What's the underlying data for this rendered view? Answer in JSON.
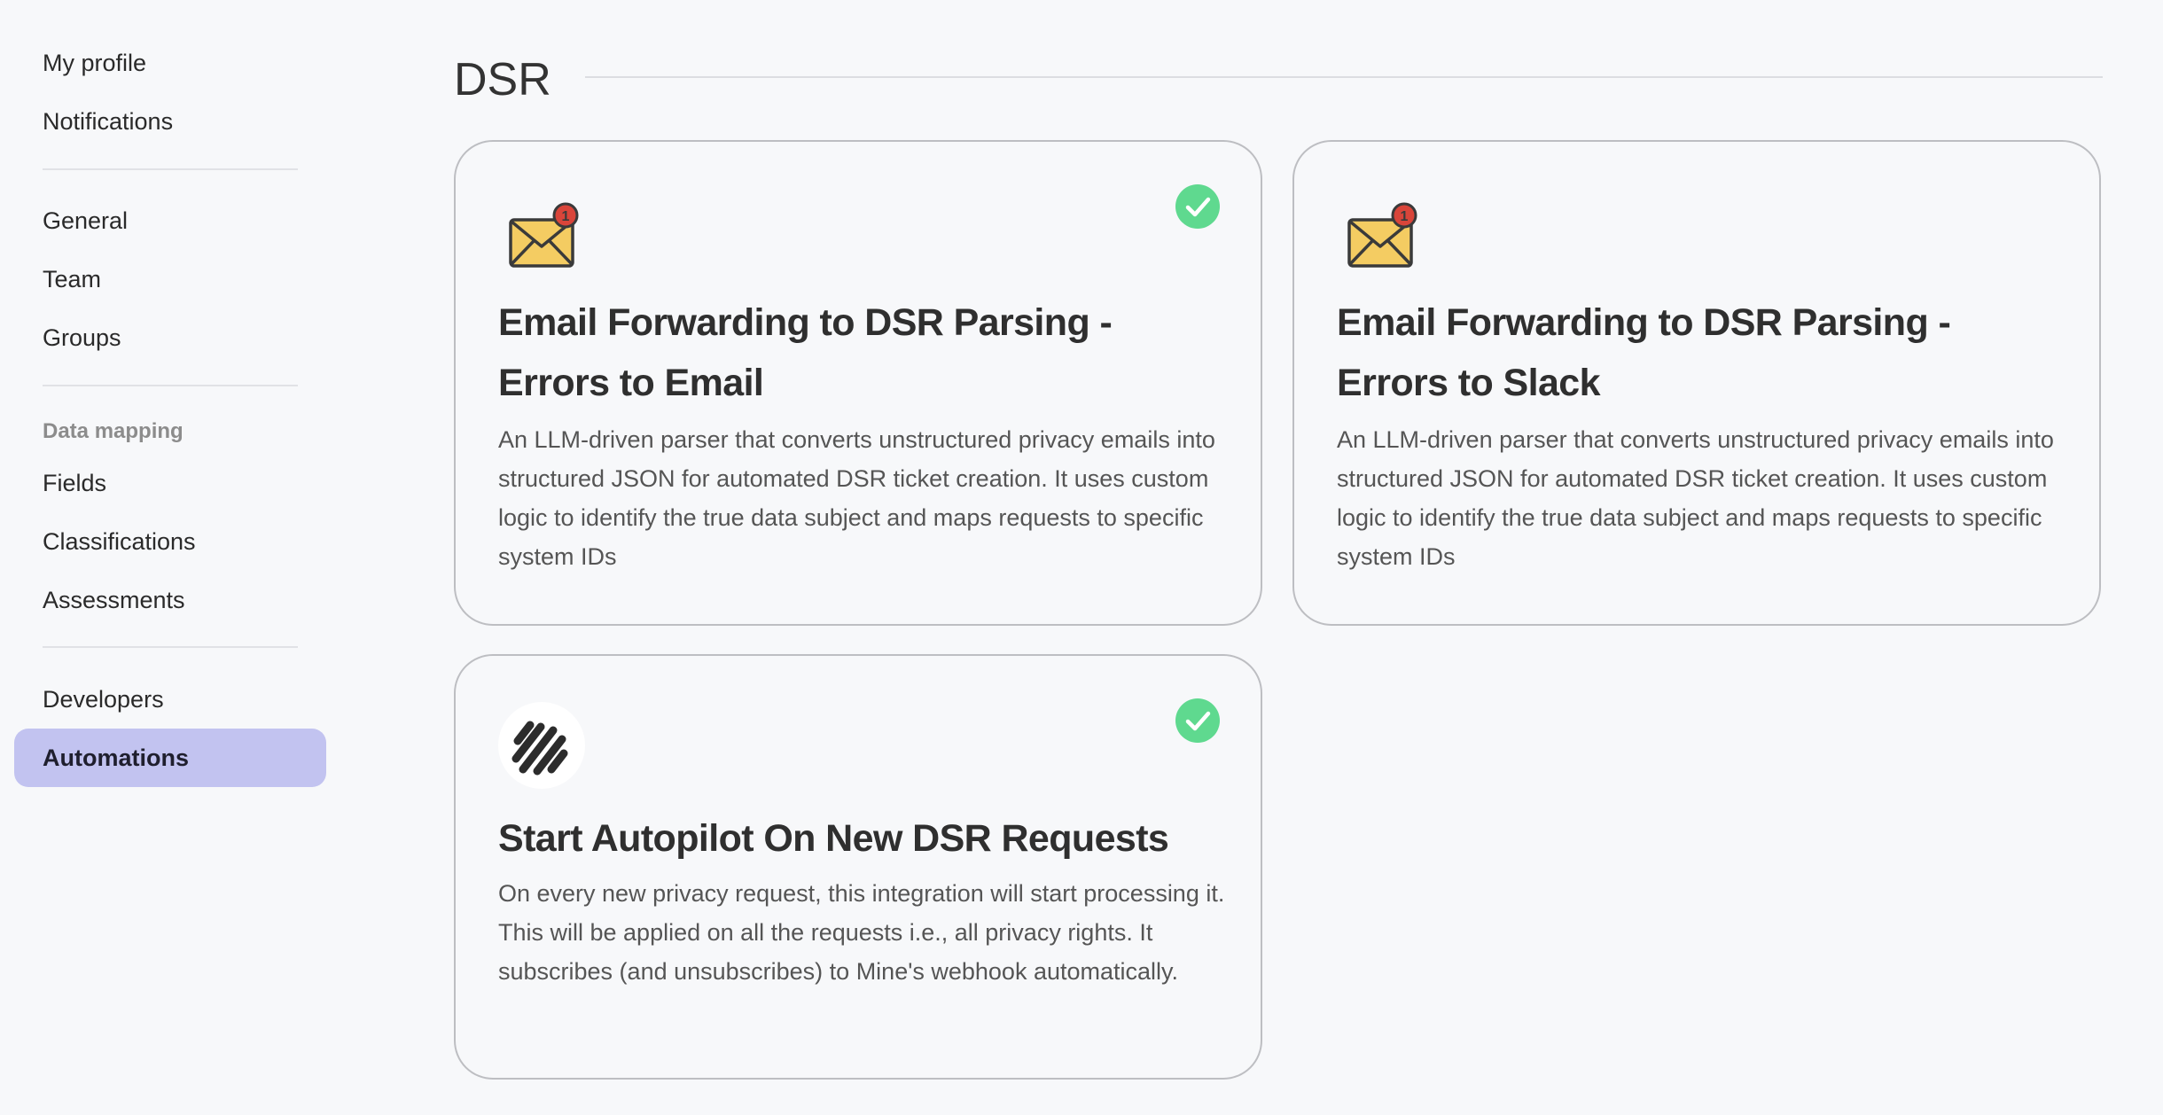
{
  "sidebar": {
    "items": [
      {
        "label": "My profile"
      },
      {
        "label": "Notifications"
      },
      {
        "label": "General"
      },
      {
        "label": "Team"
      },
      {
        "label": "Groups"
      },
      {
        "label": "Fields"
      },
      {
        "label": "Classifications"
      },
      {
        "label": "Assessments"
      },
      {
        "label": "Developers"
      },
      {
        "label": "Automations"
      }
    ],
    "section_label": "Data mapping",
    "active_item": "Automations",
    "active_color": "#c2c3f0"
  },
  "main": {
    "title": "DSR",
    "cards": [
      {
        "title": "Email Forwarding to DSR Parsing - Errors to Email",
        "description": "An LLM-driven parser that converts unstructured privacy emails into structured JSON for automated DSR ticket creation. It uses custom logic to identify the true data subject and maps requests to specific system IDs",
        "icon": "envelope-notification-icon",
        "badge_count": "1",
        "enabled": true
      },
      {
        "title": "Email Forwarding to DSR Parsing - Errors to Slack",
        "description": "An LLM-driven parser that converts unstructured privacy emails into structured JSON for automated DSR ticket creation. It uses custom logic to identify the true data subject and maps requests to specific system IDs",
        "icon": "envelope-notification-icon",
        "badge_count": "1",
        "enabled": false
      },
      {
        "title": "Start Autopilot On New DSR Requests",
        "description": "On every new privacy request, this integration will start processing it. This will be applied on all the requests i.e., all privacy rights. It subscribes (and unsubscribes) to Mine's webhook automatically.",
        "icon": "autopilot-logo-icon",
        "enabled": true
      }
    ],
    "enabled_color": "#5fd98f"
  }
}
